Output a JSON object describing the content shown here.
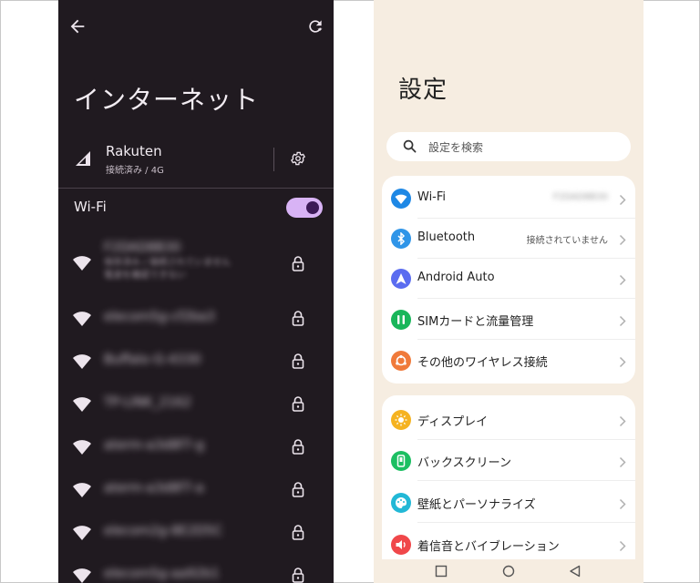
{
  "left": {
    "title": "インターネット",
    "carrier": {
      "name": "Rakuten",
      "status": "接続済み / 4G"
    },
    "wifi_label": "Wi-Fi",
    "wifi_enabled": true,
    "networks": [
      {
        "name": "F2DAD8B30",
        "sub": "保存済み / 接続されていません\n電波を確認できない"
      },
      {
        "name": "elecom5g-cf2ba3"
      },
      {
        "name": "Buffalo-G-4330"
      },
      {
        "name": "TP-LINK_2162"
      },
      {
        "name": "aterm-a3d8f7-g"
      },
      {
        "name": "aterm-a3d8f7-a"
      },
      {
        "name": "elecom2g-8E2D5C"
      },
      {
        "name": "elecom5g-aa92b1"
      }
    ],
    "icons": [
      "back-arrow-icon",
      "refresh-icon",
      "cell-signal-icon",
      "gear-icon",
      "wifi-icon",
      "lock-icon"
    ]
  },
  "right": {
    "title": "設定",
    "search_placeholder": "設定を検索",
    "group1": [
      {
        "label": "Wi-Fi",
        "value": "F2DAD8B30",
        "icon": "wifi-icon",
        "color": "#1e88e5"
      },
      {
        "label": "Bluetooth",
        "value": "接続されていません",
        "icon": "bluetooth-icon",
        "color": "#2f95e8"
      },
      {
        "label": "Android Auto",
        "value": "",
        "icon": "navigation-arrow-icon",
        "color": "#5a6cf0"
      },
      {
        "label": "SIMカードと流量管理",
        "value": "",
        "icon": "sim-card-icon",
        "color": "#19b65a"
      },
      {
        "label": "その他のワイヤレス接続",
        "value": "",
        "icon": "connection-icon",
        "color": "#f07a3a"
      }
    ],
    "group2": [
      {
        "label": "ディスプレイ",
        "icon": "brightness-icon",
        "color": "#f5b321"
      },
      {
        "label": "バックスクリーン",
        "icon": "phone-screen-icon",
        "color": "#1cbf62"
      },
      {
        "label": "壁紙とパーソナライズ",
        "icon": "palette-icon",
        "color": "#22b8d6"
      },
      {
        "label": "着信音とバイブレーション",
        "icon": "speaker-icon",
        "color": "#f0474a"
      }
    ]
  }
}
